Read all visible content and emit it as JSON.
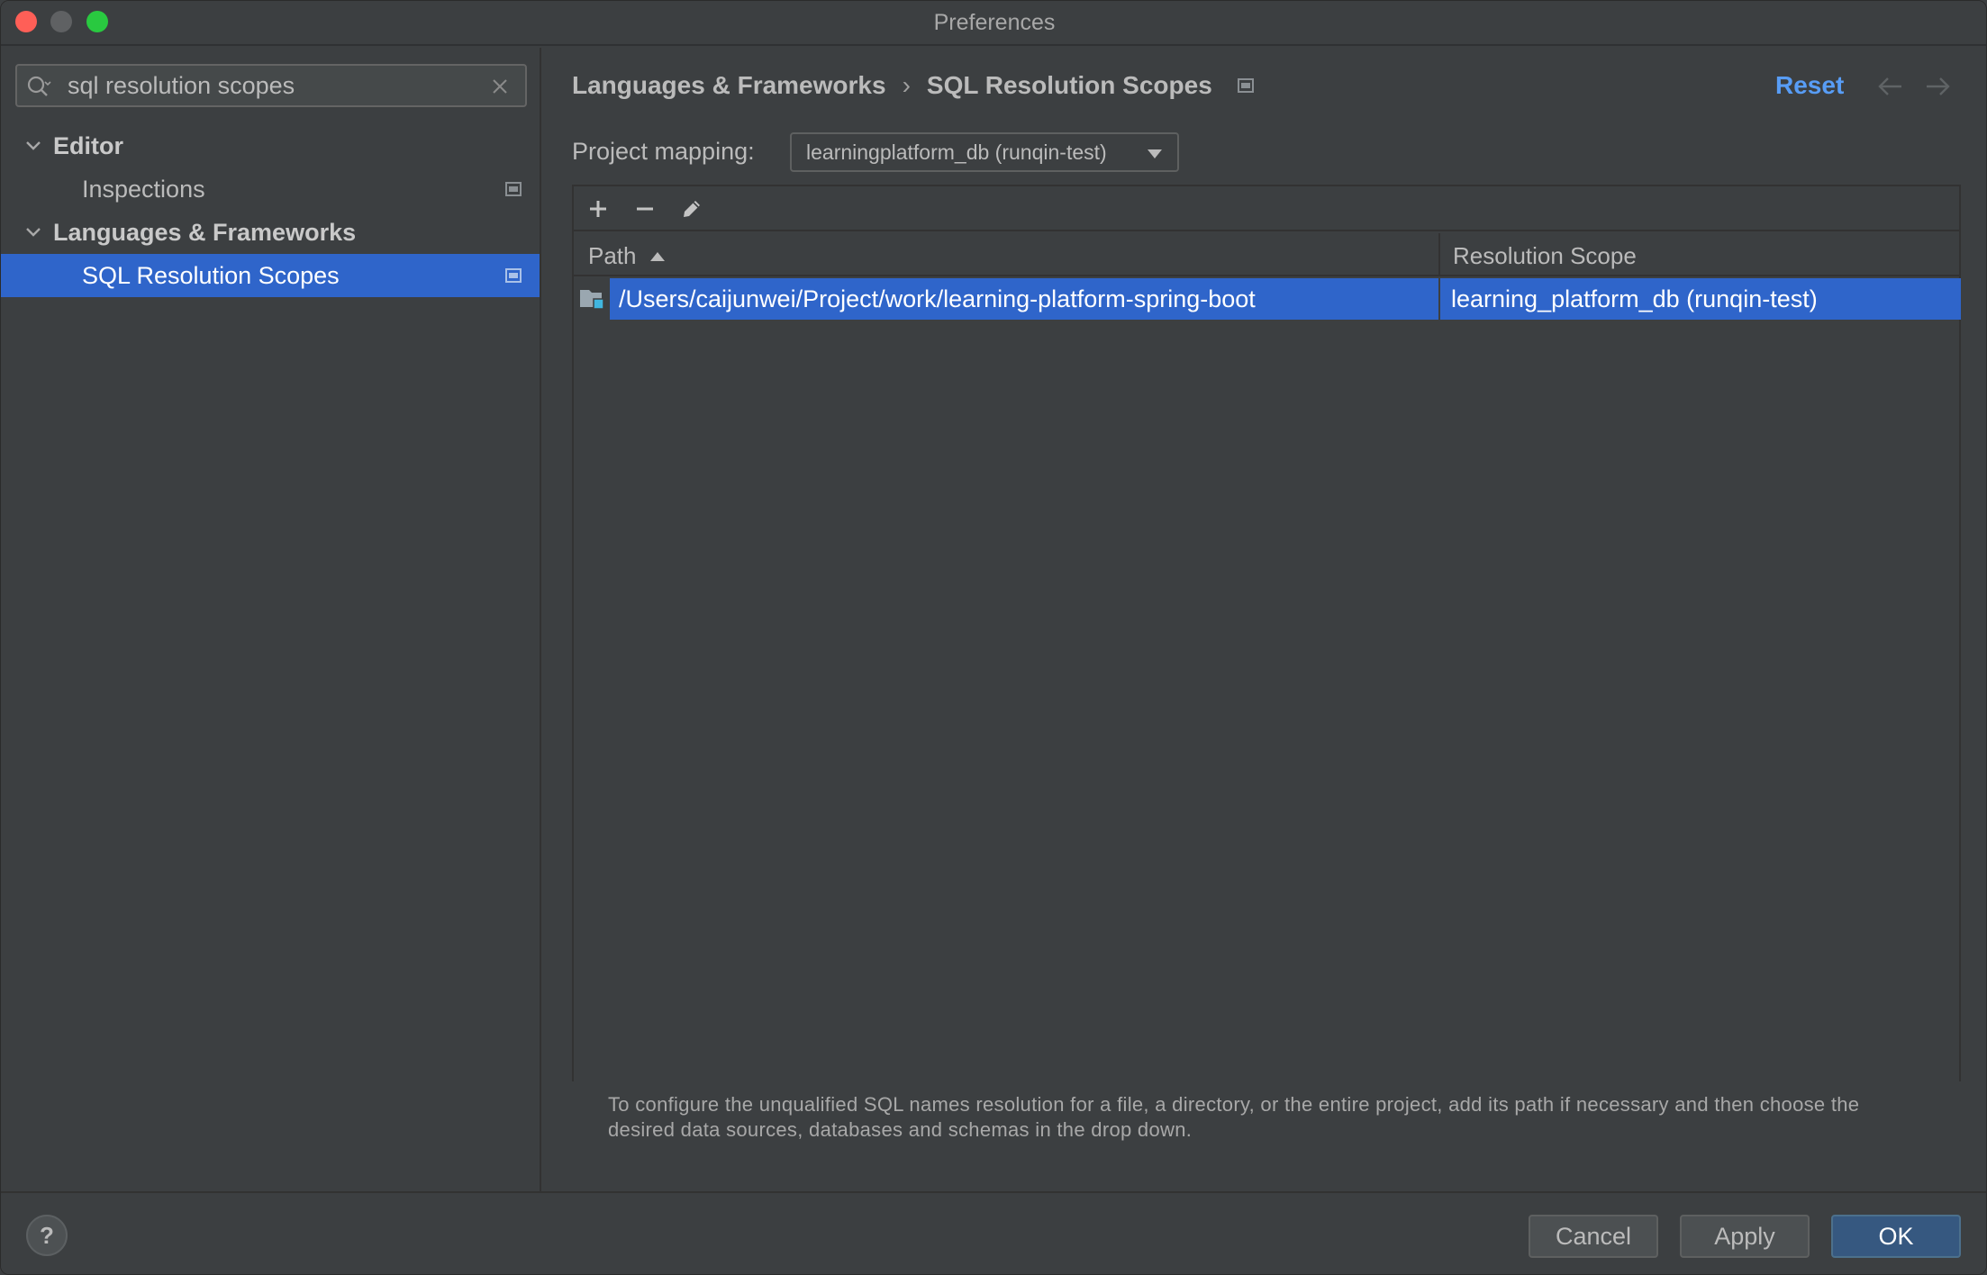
{
  "window": {
    "title": "Preferences"
  },
  "sidebar": {
    "search": {
      "value": "sql resolution scopes"
    },
    "tree": [
      {
        "label": "Editor",
        "type": "group"
      },
      {
        "label": "Inspections",
        "type": "child"
      },
      {
        "label": "Languages & Frameworks",
        "type": "group"
      },
      {
        "label": "SQL Resolution Scopes",
        "type": "child",
        "selected": true
      }
    ]
  },
  "main": {
    "breadcrumb": {
      "parent": "Languages & Frameworks",
      "separator": "›",
      "current": "SQL Resolution Scopes"
    },
    "reset_label": "Reset",
    "mapping": {
      "label": "Project mapping:",
      "value": "learningplatform_db (runqin-test)"
    },
    "table": {
      "columns": [
        "Path",
        "Resolution Scope"
      ],
      "rows": [
        {
          "path": "/Users/caijunwei/Project/work/learning-platform-spring-boot",
          "scope": "learning_platform_db (runqin-test)"
        }
      ]
    },
    "hint": "To configure the unqualified SQL names resolution for a file, a directory, or the entire project, add its path if necessary and then choose the desired data sources, databases and schemas in the drop down."
  },
  "footer": {
    "help": "?",
    "cancel": "Cancel",
    "apply": "Apply",
    "ok": "OK"
  },
  "colors": {
    "selection": "#2f65ca",
    "link": "#589df6",
    "background": "#3c3f41"
  }
}
